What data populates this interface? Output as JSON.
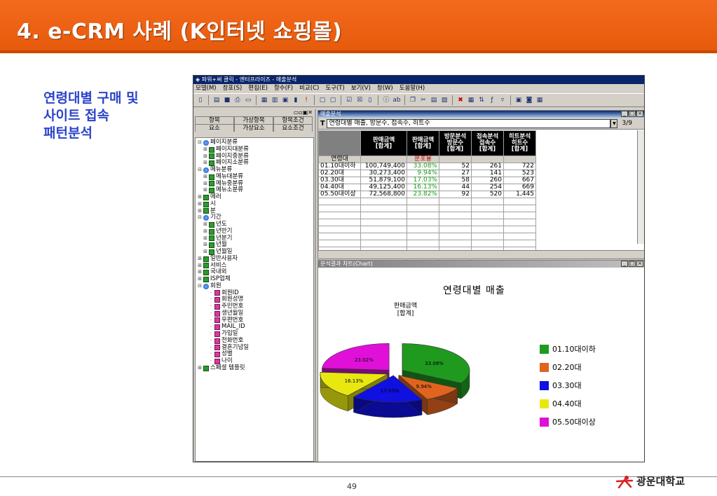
{
  "slide": {
    "title": "4. e-CRM 사례 (K인터넷 쇼핑몰)",
    "caption_lines": [
      "연령대별 구매 및",
      "사이트 접속",
      "패턴분석"
    ],
    "page_number": "49",
    "logo_text": "광운대학교",
    "colors": {
      "title_bg": "#f46a1c",
      "caption": "#2b44c9"
    }
  },
  "app": {
    "title": "파워+써 클릭 - 엔터프라이즈 - 매출분석",
    "menu": [
      "모델(M)",
      "창포(S)",
      "편집(E)",
      "항수(F)",
      "비교(C)",
      "도구(T)",
      "보기(V)",
      "창(W)",
      "도움말(H)"
    ],
    "left_panel": {
      "tabs": [
        "항목",
        "가상항목",
        "항목조건",
        "요소",
        "가상요소",
        "요소조건"
      ],
      "tree": [
        {
          "label": "페이지분류",
          "level": 0,
          "exp": "⊟",
          "icon": "globe"
        },
        {
          "label": "페이지대분류",
          "level": 1,
          "exp": "⊞",
          "icon": "folder"
        },
        {
          "label": "페이지중분류",
          "level": 1,
          "exp": "⊞",
          "icon": "folder"
        },
        {
          "label": "페이지소분류",
          "level": 1,
          "exp": "⊞",
          "icon": "folder"
        },
        {
          "label": "메뉴분류",
          "level": 0,
          "exp": "⊟",
          "icon": "globe"
        },
        {
          "label": "메뉴대분류",
          "level": 1,
          "exp": "⊞",
          "icon": "folder"
        },
        {
          "label": "메뉴중분류",
          "level": 1,
          "exp": "⊞",
          "icon": "folder"
        },
        {
          "label": "메뉴소분류",
          "level": 1,
          "exp": "⊞",
          "icon": "folder"
        },
        {
          "label": "에러",
          "level": 0,
          "exp": "⊞",
          "icon": "folder"
        },
        {
          "label": "시",
          "level": 0,
          "exp": "⊞",
          "icon": "folder"
        },
        {
          "label": "분",
          "level": 0,
          "exp": "⊞",
          "icon": "folder"
        },
        {
          "label": "기간",
          "level": 0,
          "exp": "⊟",
          "icon": "globe"
        },
        {
          "label": "년도",
          "level": 1,
          "exp": "⊞",
          "icon": "folder"
        },
        {
          "label": "년반기",
          "level": 1,
          "exp": "⊞",
          "icon": "folder"
        },
        {
          "label": "년분기",
          "level": 1,
          "exp": "⊞",
          "icon": "folder"
        },
        {
          "label": "년월",
          "level": 1,
          "exp": "⊞",
          "icon": "folder"
        },
        {
          "label": "년월일",
          "level": 1,
          "exp": "⊞",
          "icon": "folder"
        },
        {
          "label": "일반사용자",
          "level": 0,
          "exp": "⊞",
          "icon": "folder"
        },
        {
          "label": "서비스",
          "level": 0,
          "exp": "⊞",
          "icon": "folder"
        },
        {
          "label": "국내외",
          "level": 0,
          "exp": "⊞",
          "icon": "folder"
        },
        {
          "label": "ISP업체",
          "level": 0,
          "exp": "⊞",
          "icon": "folder"
        },
        {
          "label": "회원",
          "level": 0,
          "exp": "⊟",
          "icon": "globe"
        },
        {
          "label": "회원ID",
          "level": 2,
          "exp": "",
          "icon": "leaf"
        },
        {
          "label": "회원성명",
          "level": 2,
          "exp": "",
          "icon": "leaf"
        },
        {
          "label": "주민번호",
          "level": 2,
          "exp": "",
          "icon": "leaf"
        },
        {
          "label": "생년월일",
          "level": 2,
          "exp": "",
          "icon": "leaf"
        },
        {
          "label": "우편번호",
          "level": 2,
          "exp": "",
          "icon": "leaf"
        },
        {
          "label": "MAIL_ID",
          "level": 2,
          "exp": "",
          "icon": "leaf"
        },
        {
          "label": "가입일",
          "level": 2,
          "exp": "",
          "icon": "leaf"
        },
        {
          "label": "전화번호",
          "level": 2,
          "exp": "",
          "icon": "leaf"
        },
        {
          "label": "결혼기념일",
          "level": 2,
          "exp": "",
          "icon": "leaf"
        },
        {
          "label": "성별",
          "level": 2,
          "exp": "",
          "icon": "leaf"
        },
        {
          "label": "나이",
          "level": 2,
          "exp": "",
          "icon": "leaf"
        },
        {
          "label": "스페셜 템플릿",
          "level": 0,
          "exp": "⊞",
          "icon": "folder"
        }
      ]
    },
    "grid_window": {
      "title": "매출분석",
      "query_prefix": "T",
      "query": "연령대별 매출, 방문수, 접속수, 히트수",
      "page": "3/9",
      "columns": [
        "판매금액\n[합계]",
        "판매금액\n[합계]",
        "방문분석\n방문수\n[합계]",
        "접속분석\n접속수\n[합계]",
        "히트분석\n히트수\n[합계]"
      ],
      "row_header_label": "연령대",
      "pct_header": "분포율",
      "rows": [
        {
          "label": "01.10대이하",
          "amount": "100,749,400",
          "pct": "33.08%",
          "visits": "52",
          "sessions": "261",
          "hits": "722"
        },
        {
          "label": "02.20대",
          "amount": "30,273,400",
          "pct": "9.94%",
          "visits": "27",
          "sessions": "141",
          "hits": "523"
        },
        {
          "label": "03.30대",
          "amount": "51,879,100",
          "pct": "17.03%",
          "visits": "58",
          "sessions": "260",
          "hits": "667"
        },
        {
          "label": "04.40대",
          "amount": "49,125,400",
          "pct": "16.13%",
          "visits": "44",
          "sessions": "254",
          "hits": "669"
        },
        {
          "label": "05.50대이상",
          "amount": "72,568,800",
          "pct": "23.82%",
          "visits": "92",
          "sessions": "520",
          "hits": "1,445"
        }
      ]
    },
    "chart_window": {
      "title": "분석결과 차트(Chart)"
    }
  },
  "chart_data": {
    "type": "pie",
    "title": "연령대별 매출",
    "subtitle": "판매금액\n[합계]",
    "categories": [
      "01.10대이하",
      "02.20대",
      "03.30대",
      "04.40대",
      "05.50대이상"
    ],
    "values": [
      33.08,
      9.94,
      17.03,
      16.13,
      23.82
    ],
    "labels": [
      "33.08%",
      "9.94%",
      "17.03%",
      "16.13%",
      "23.02%"
    ],
    "colors": [
      "#1f9a1f",
      "#e0641e",
      "#1010e0",
      "#e8e810",
      "#e010d8"
    ],
    "legend_position": "right"
  }
}
